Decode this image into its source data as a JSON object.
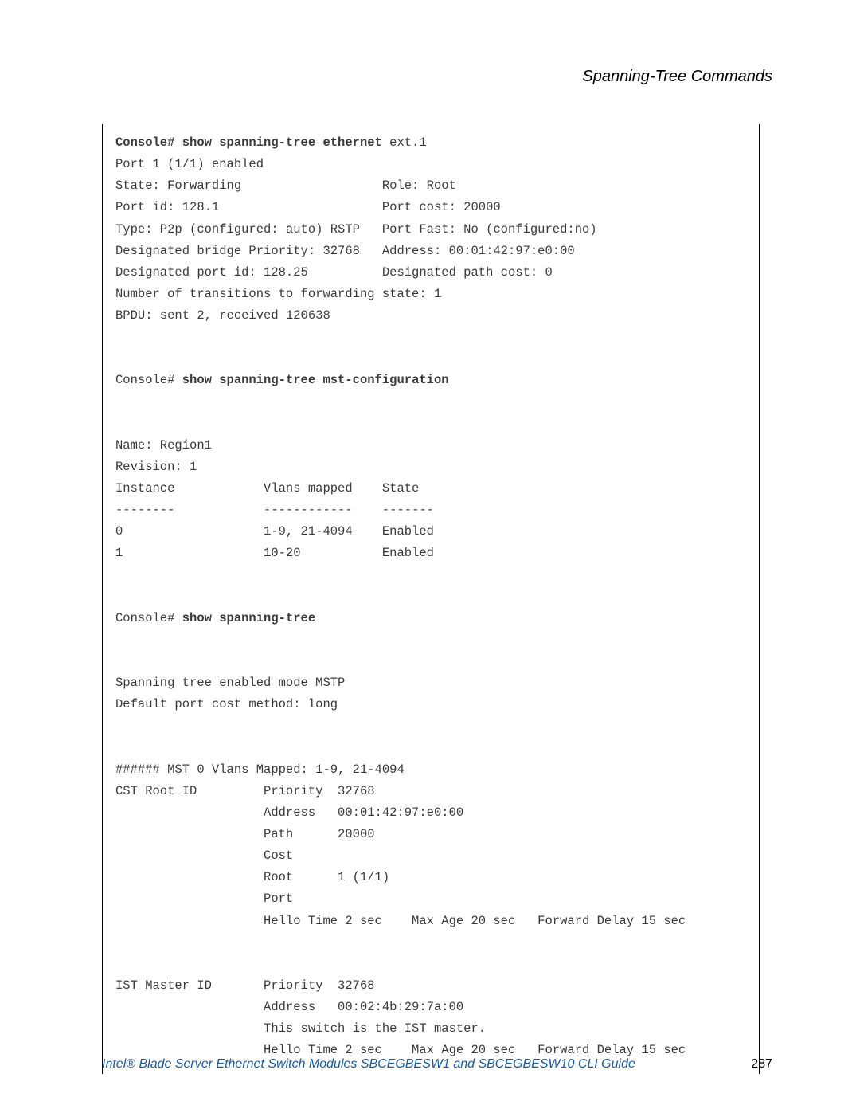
{
  "header": {
    "chapter_title": "Spanning-Tree Commands"
  },
  "cli": {
    "cmd1_prefix": "Console# show spanning-tree ethernet ",
    "cmd1_arg": "ext.1",
    "port_enabled": "Port 1 (1/1) enabled",
    "row_state_l": "State: Forwarding",
    "row_state_r": "Role: Root",
    "row_portid_l": "Port id: 128.1",
    "row_portid_r": "Port cost: 20000",
    "row_type_l": "Type: P2p (configured: auto) RSTP",
    "row_type_r": "Port Fast: No (configured:no)",
    "row_dbridge_l": "Designated bridge Priority: 32768",
    "row_dbridge_r": "Address: 00:01:42:97:e0:00",
    "row_dport_l": "Designated port id: 128.25",
    "row_dport_r": "Designated path cost: 0",
    "transitions": "Number of transitions to forwarding state: 1",
    "bpdu": "BPDU: sent 2, received 120638",
    "cmd2_prefix": "Console# ",
    "cmd2_bold": "show spanning-tree mst-configuration",
    "mst_name": "Name: Region1",
    "mst_rev": "Revision: 1",
    "mst_hdr_instance": "Instance",
    "mst_hdr_vlans": "Vlans mapped",
    "mst_hdr_state": "State",
    "mst_sep_instance": "--------",
    "mst_sep_vlans": "------------",
    "mst_sep_state": "-------",
    "mst_row0_inst": "0",
    "mst_row0_vlans": "1-9, 21-4094",
    "mst_row0_state": "Enabled",
    "mst_row1_inst": "1",
    "mst_row1_vlans": "10-20",
    "mst_row1_state": "Enabled",
    "cmd3_prefix": "Console# ",
    "cmd3_bold": "show spanning-tree",
    "st_enabled": "Spanning tree enabled mode MSTP",
    "st_costmethod": "Default port cost method: long",
    "mst0_header": "###### MST 0 Vlans Mapped: 1-9, 21-4094",
    "cst_label": "CST Root ID",
    "cst_priority_k": "Priority",
    "cst_priority_v": "32768",
    "cst_address_k": "Address",
    "cst_address_v": "00:01:42:97:e0:00",
    "cst_path_k1": "Path",
    "cst_path_k2": "Cost",
    "cst_path_v": "20000",
    "cst_root_k1": "Root",
    "cst_root_k2": "Port",
    "cst_root_v": "1 (1/1)",
    "cst_timers_hello": "Hello Time 2 sec",
    "cst_timers_maxage": "Max Age 20 sec",
    "cst_timers_fwd": "Forward Delay 15 sec",
    "ist_label": "IST Master ID",
    "ist_priority_k": "Priority",
    "ist_priority_v": "32768",
    "ist_address_k": "Address",
    "ist_address_v": "00:02:4b:29:7a:00",
    "ist_note": "This switch is the IST master.",
    "ist_timers_hello": "Hello Time 2 sec",
    "ist_timers_maxage": "Max Age 20 sec",
    "ist_timers_fwd": "Forward Delay 15 sec"
  },
  "footer": {
    "left": "Intel® Blade Server Ethernet Switch Modules SBCEGBESW1 and SBCEGBESW10 CLI Guide",
    "page_number": "287"
  }
}
